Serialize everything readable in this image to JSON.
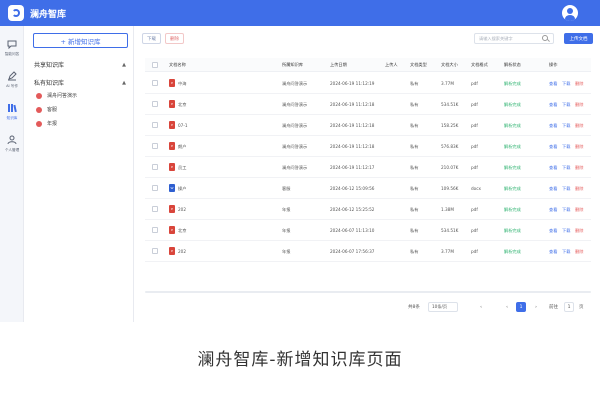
{
  "app": {
    "title": "澜舟智库"
  },
  "nav": [
    {
      "label": "智能问答",
      "icon": "chat-icon"
    },
    {
      "label": "AI 写作",
      "icon": "pen-icon"
    },
    {
      "label": "知识库",
      "icon": "books-icon"
    },
    {
      "label": "个人管理",
      "icon": "person-icon"
    }
  ],
  "sidebar": {
    "add_button": "+ 新增知识库",
    "shared_heading": "共享知识库",
    "private_heading": "私有知识库",
    "private_items": [
      "澜舟问答演示",
      "客服",
      "年报"
    ]
  },
  "toolbar": {
    "download": "下载",
    "delete": "删除",
    "search_placeholder": "请输入搜索关键字",
    "upload": "上传文档"
  },
  "table": {
    "columns": [
      "文档名称",
      "所属知识库",
      "上传日期",
      "上传人",
      "文档类型",
      "文档大小",
      "文档格式",
      "解析状态",
      "操作"
    ],
    "rows": [
      {
        "name": "中海",
        "kb": "澜舟问答演示",
        "date": "2024-06-19 11:12:19",
        "uploader": "",
        "type": "私有",
        "size": "3.77M",
        "format": "pdf",
        "status": "解析完成",
        "kind": "pdf"
      },
      {
        "name": "北京",
        "kb": "澜舟问答演示",
        "date": "2024-06-19 11:12:18",
        "uploader": "",
        "type": "私有",
        "size": "534.51K",
        "format": "pdf",
        "status": "解析完成",
        "kind": "pdf"
      },
      {
        "name": "07-1",
        "kb": "澜舟问答演示",
        "date": "2024-06-19 11:12:18",
        "uploader": "",
        "type": "私有",
        "size": "158.25K",
        "format": "pdf",
        "status": "解析完成",
        "kind": "pdf"
      },
      {
        "name": "朗户",
        "kb": "澜舟问答演示",
        "date": "2024-06-19 11:12:18",
        "uploader": "",
        "type": "私有",
        "size": "576.83K",
        "format": "pdf",
        "status": "解析完成",
        "kind": "pdf"
      },
      {
        "name": "员工",
        "kb": "澜舟问答演示",
        "date": "2024-06-19 11:12:17",
        "uploader": "",
        "type": "私有",
        "size": "210.07K",
        "format": "pdf",
        "status": "解析完成",
        "kind": "pdf"
      },
      {
        "name": "操户",
        "kb": "客服",
        "date": "2024-06-12 15:09:56",
        "uploader": "",
        "type": "私有",
        "size": "109.56K",
        "format": "docx",
        "status": "解析完成",
        "kind": "word"
      },
      {
        "name": "202",
        "kb": "年报",
        "date": "2024-06-12 15:25:52",
        "uploader": "",
        "type": "私有",
        "size": "1.38M",
        "format": "pdf",
        "status": "解析完成",
        "kind": "pdf"
      },
      {
        "name": "北京",
        "kb": "年报",
        "date": "2024-06-07 11:13:10",
        "uploader": "",
        "type": "私有",
        "size": "534.51K",
        "format": "pdf",
        "status": "解析完成",
        "kind": "pdf"
      },
      {
        "name": "202",
        "kb": "年报",
        "date": "2024-06-07 17:56:37",
        "uploader": "",
        "type": "私有",
        "size": "3.77M",
        "format": "pdf",
        "status": "解析完成",
        "kind": "pdf"
      }
    ],
    "actions": {
      "view": "查看",
      "download": "下载",
      "delete": "删除"
    }
  },
  "pagination": {
    "total": "共8条",
    "page_size": "10条/页",
    "current": "1",
    "goto": "前往",
    "goto_value": "1",
    "unit": "页"
  },
  "caption": "澜舟智库-新增知识库页面"
}
